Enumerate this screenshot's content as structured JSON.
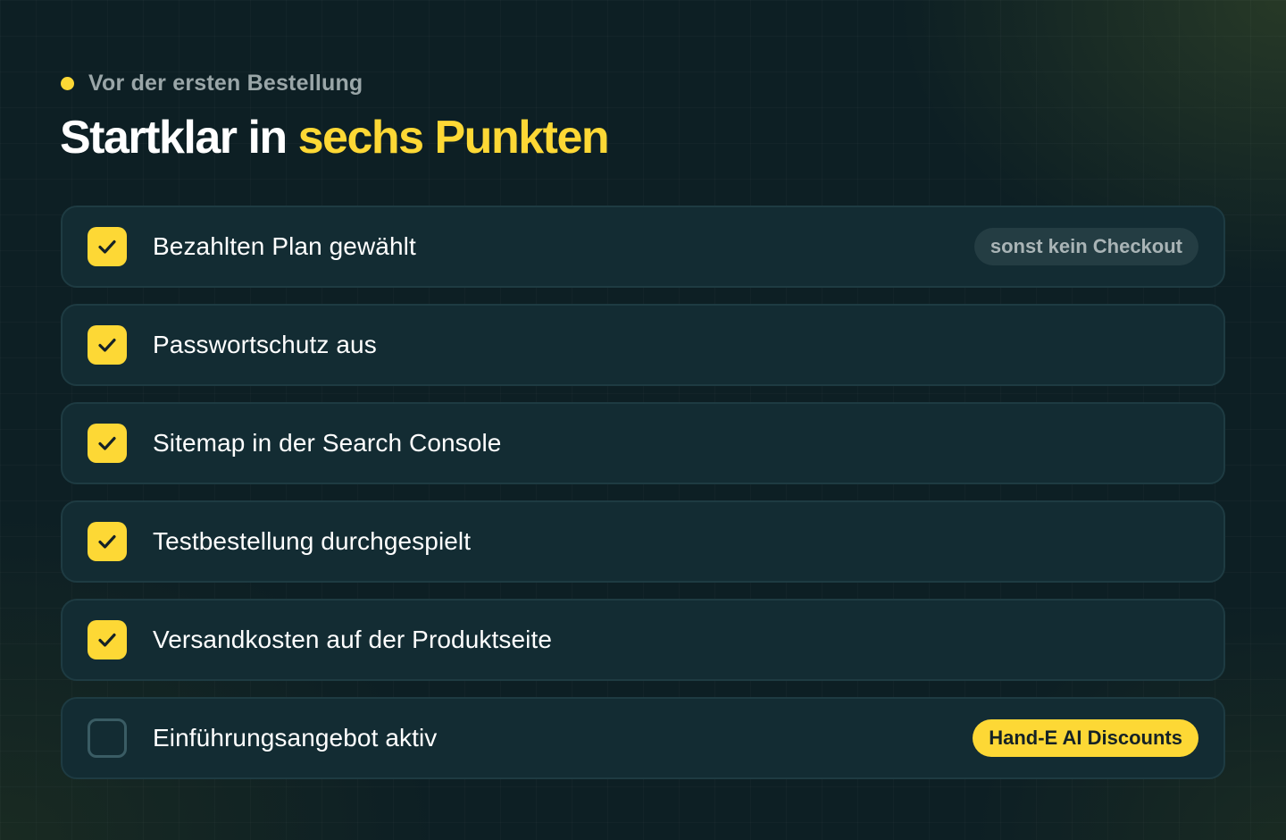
{
  "header": {
    "eyebrow": "Vor der ersten Bestellung",
    "title_main": "Startklar in ",
    "title_accent": "sechs Punkten"
  },
  "checklist": [
    {
      "label": "Bezahlten Plan gewählt",
      "checked": true,
      "badge": "sonst kein Checkout",
      "badge_style": "muted"
    },
    {
      "label": "Passwortschutz aus",
      "checked": true
    },
    {
      "label": "Sitemap in der Search Console",
      "checked": true
    },
    {
      "label": "Testbestellung durchgespielt",
      "checked": true
    },
    {
      "label": "Versandkosten auf der Produktseite",
      "checked": true
    },
    {
      "label": "Einführungsangebot aktiv",
      "checked": false,
      "badge": "Hand-E AI Discounts",
      "badge_style": "accent"
    }
  ],
  "icons": {
    "checked": "checkmark-icon",
    "eyebrow": "dot-icon"
  },
  "colors": {
    "accent": "#fdd835",
    "background": "#0d1f24",
    "card": "#132c33",
    "card_border": "#1e3b42",
    "muted_text": "#9aa6a8"
  }
}
